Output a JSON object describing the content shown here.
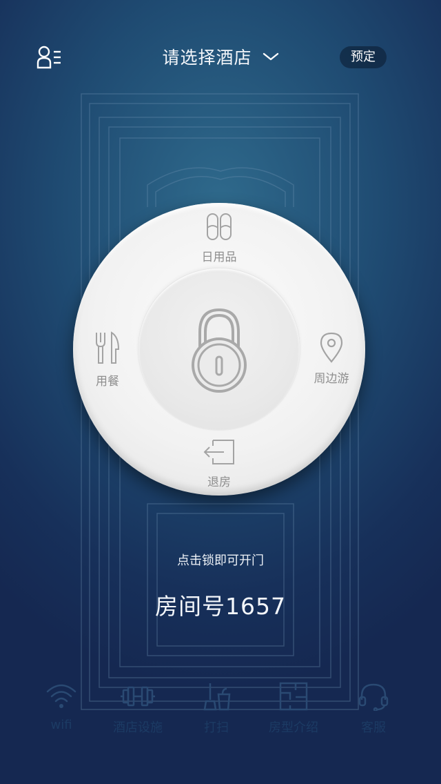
{
  "header": {
    "title": "请选择酒店",
    "reserve_label": "预定"
  },
  "dial": {
    "top_label": "日用品",
    "left_label": "用餐",
    "right_label": "周边游",
    "bottom_label": "退房"
  },
  "hint": "点击锁即可开门",
  "room_number": "房间号1657",
  "tabs": [
    {
      "label": "wifi",
      "icon": "wifi-icon"
    },
    {
      "label": "酒店设施",
      "icon": "dumbbell-icon"
    },
    {
      "label": "打扫",
      "icon": "cleaning-icon"
    },
    {
      "label": "房型介绍",
      "icon": "floorplan-icon"
    },
    {
      "label": "客服",
      "icon": "headset-icon"
    }
  ],
  "colors": {
    "background_top": "#2f6a8c",
    "background_bottom": "#152851",
    "dial": "#f2f2f2",
    "icon_gray": "#a3a3a3",
    "tab_inactive": "#1c3b64"
  }
}
